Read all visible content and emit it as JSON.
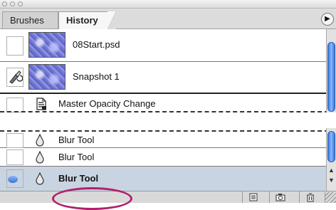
{
  "tabs": {
    "brushes": "Brushes",
    "history": "History"
  },
  "history_top": [
    {
      "label": "08Start.psd",
      "kind": "snapshot"
    },
    {
      "label": "Snapshot 1",
      "kind": "snapshot"
    },
    {
      "label": "Master Opacity Change",
      "kind": "state"
    }
  ],
  "history_bottom": [
    {
      "label": "Blur Tool"
    },
    {
      "label": "Blur Tool"
    },
    {
      "label": "Blur Tool",
      "selected": true
    }
  ],
  "icons": {
    "panel_menu": "panel-menu-arrow-icon",
    "history_brush": "history-brush-icon",
    "state_document": "document-icon",
    "blur_tool": "blur-drop-icon",
    "new_document": "new-document-icon",
    "new_snapshot": "camera-icon",
    "delete": "trash-icon"
  },
  "colors": {
    "selected_row": "#c9d4e2",
    "highlight_ellipse": "#b0206e",
    "scroll_thumb": "#3b78d9"
  }
}
